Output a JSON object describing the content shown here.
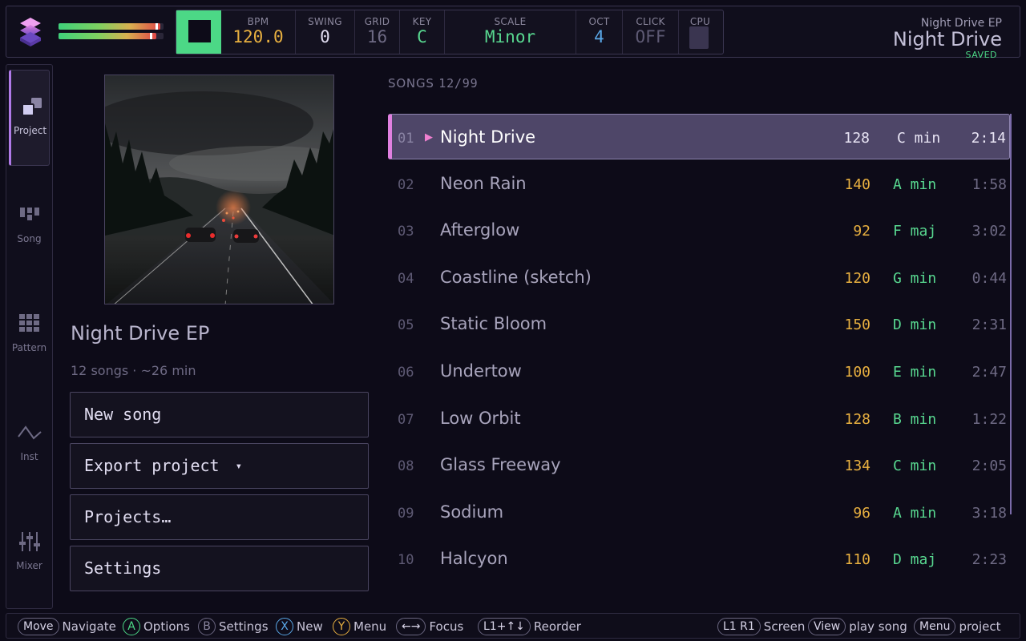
{
  "colors": {
    "accent": "#b07ae8",
    "play_green": "#4cd886",
    "bpm_amber": "#e8b040",
    "key_green": "#58d890",
    "oct_blue": "#5aa8e8",
    "selection": "#4e4668",
    "selection_marker": "#e080e0"
  },
  "meters": {
    "left_level": 0.97,
    "right_level": 0.93
  },
  "transport": {
    "stop_icon": "stop-icon",
    "bpm": {
      "label": "BPM",
      "value": "120.0"
    },
    "swing": {
      "label": "SWING",
      "value": "0"
    },
    "grid": {
      "label": "GRID",
      "value": "16"
    },
    "key": {
      "label": "KEY",
      "value": "C"
    },
    "scale": {
      "label": "SCALE",
      "value": "Minor"
    },
    "oct": {
      "label": "OCT",
      "value": "4"
    },
    "click": {
      "label": "CLICK",
      "value": "OFF"
    },
    "cpu": {
      "label": "CPU"
    }
  },
  "project_header": {
    "subtitle": "Night Drive EP",
    "title": "Night Drive",
    "status": "SAVED"
  },
  "nav": {
    "items": [
      {
        "label": "Project",
        "icon": "project-icon"
      },
      {
        "label": "Song",
        "icon": "song-icon"
      },
      {
        "label": "Pattern",
        "icon": "pattern-icon"
      },
      {
        "label": "Inst",
        "icon": "instrument-icon"
      },
      {
        "label": "Mixer",
        "icon": "mixer-icon"
      }
    ]
  },
  "project": {
    "title": "Night Drive EP",
    "meta": "12 songs · ~26 min",
    "buttons": {
      "new_song": "New song",
      "export": "Export project",
      "export_caret": "▾",
      "projects": "Projects…",
      "settings": "Settings"
    }
  },
  "songs": {
    "header_label": "SONGS",
    "header_count": "12/99",
    "rows": [
      {
        "num": "01",
        "name": "Night Drive",
        "bpm": "128",
        "key": "C min",
        "dur": "2:14"
      },
      {
        "num": "02",
        "name": "Neon Rain",
        "bpm": "140",
        "key": "A min",
        "dur": "1:58"
      },
      {
        "num": "03",
        "name": "Afterglow",
        "bpm": "92",
        "key": "F maj",
        "dur": "3:02"
      },
      {
        "num": "04",
        "name": "Coastline (sketch)",
        "bpm": "120",
        "key": "G min",
        "dur": "0:44"
      },
      {
        "num": "05",
        "name": "Static Bloom",
        "bpm": "150",
        "key": "D min",
        "dur": "2:31"
      },
      {
        "num": "06",
        "name": "Undertow",
        "bpm": "100",
        "key": "E min",
        "dur": "2:47"
      },
      {
        "num": "07",
        "name": "Low Orbit",
        "bpm": "128",
        "key": "B min",
        "dur": "1:22"
      },
      {
        "num": "08",
        "name": "Glass Freeway",
        "bpm": "134",
        "key": "C min",
        "dur": "2:05"
      },
      {
        "num": "09",
        "name": "Sodium",
        "bpm": "96",
        "key": "A min",
        "dur": "3:18"
      },
      {
        "num": "10",
        "name": "Halcyon",
        "bpm": "110",
        "key": "D maj",
        "dur": "2:23"
      }
    ],
    "play_glyph": "▶"
  },
  "hints": {
    "move": {
      "key": "Move",
      "text": "Navigate"
    },
    "a": {
      "key": "A",
      "text": "Options"
    },
    "b": {
      "key": "B",
      "text": "Settings"
    },
    "x": {
      "key": "X",
      "text": "New"
    },
    "y": {
      "key": "Y",
      "text": "Menu"
    },
    "focus": {
      "key": "←→",
      "text": "Focus"
    },
    "reorder": {
      "key": "L1+↑↓",
      "text": "Reorder"
    },
    "screen": {
      "key": "L1 R1",
      "text": "Screen"
    },
    "view": {
      "key": "View",
      "text": "play song"
    },
    "menu": {
      "key": "Menu",
      "text": "project"
    }
  }
}
